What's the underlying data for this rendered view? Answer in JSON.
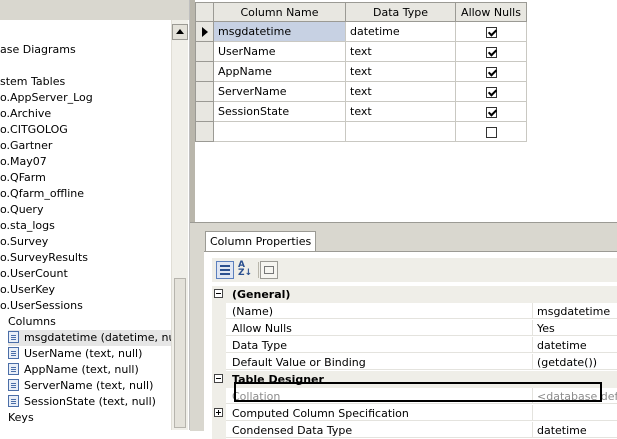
{
  "tree": {
    "nodes": [
      {
        "label": "ase Diagrams",
        "icon": ""
      },
      {
        "label": "",
        "icon": ""
      },
      {
        "label": "stem Tables",
        "icon": ""
      },
      {
        "label": "o.AppServer_Log",
        "icon": ""
      },
      {
        "label": "o.Archive",
        "icon": ""
      },
      {
        "label": "o.CITGOLOG",
        "icon": ""
      },
      {
        "label": "o.Gartner",
        "icon": ""
      },
      {
        "label": "o.May07",
        "icon": ""
      },
      {
        "label": "o.QFarm",
        "icon": ""
      },
      {
        "label": "o.Qfarm_offline",
        "icon": ""
      },
      {
        "label": "o.Query",
        "icon": ""
      },
      {
        "label": "o.sta_logs",
        "icon": ""
      },
      {
        "label": "o.Survey",
        "icon": ""
      },
      {
        "label": "o.SurveyResults",
        "icon": ""
      },
      {
        "label": "o.UserCount",
        "icon": ""
      },
      {
        "label": "o.UserKey",
        "icon": ""
      },
      {
        "label": "o.UserSessions",
        "icon": ""
      },
      {
        "label": "Columns",
        "icon": ""
      },
      {
        "label": "msgdatetime (datetime, null)",
        "icon": "column-icon"
      },
      {
        "label": "UserName (text, null)",
        "icon": "column-icon"
      },
      {
        "label": "AppName (text, null)",
        "icon": "column-icon"
      },
      {
        "label": "ServerName (text, null)",
        "icon": "column-icon"
      },
      {
        "label": "SessionState (text, null)",
        "icon": "column-icon"
      },
      {
        "label": "Keys",
        "icon": ""
      }
    ]
  },
  "grid": {
    "headers": [
      "Column Name",
      "Data Type",
      "Allow Nulls"
    ],
    "rows": [
      {
        "name": "msgdatetime",
        "type": "datetime",
        "nulls": true
      },
      {
        "name": "UserName",
        "type": "text",
        "nulls": true
      },
      {
        "name": "AppName",
        "type": "text",
        "nulls": true
      },
      {
        "name": "ServerName",
        "type": "text",
        "nulls": true
      },
      {
        "name": "SessionState",
        "type": "text",
        "nulls": true
      },
      {
        "name": "",
        "type": "",
        "nulls": false
      }
    ]
  },
  "properties": {
    "tab_label": "Column Properties",
    "general_label": "(General)",
    "general_rows": [
      {
        "name": "(Name)",
        "value": "msgdatetime"
      },
      {
        "name": "Allow Nulls",
        "value": "Yes"
      },
      {
        "name": "Data Type",
        "value": "datetime"
      },
      {
        "name": "Default Value or Binding",
        "value": "(getdate())"
      }
    ],
    "designer_label": "Table Designer",
    "designer_rows": [
      {
        "name": "Collation",
        "value": "<database defau"
      },
      {
        "name": "Computed Column Specification",
        "value": ""
      },
      {
        "name": "Condensed Data Type",
        "value": "datetime"
      }
    ]
  }
}
